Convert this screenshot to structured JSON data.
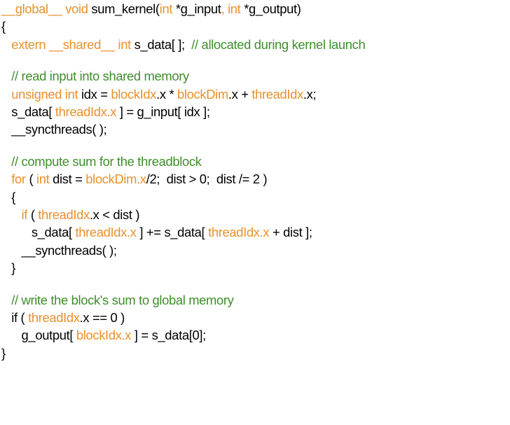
{
  "colors": {
    "keyword": "#e8912c",
    "comment": "#3f8e2b",
    "text": "#000000",
    "background": "#ffffff"
  },
  "code": {
    "lines": [
      {
        "tokens": [
          [
            "o",
            "__global__ void "
          ],
          [
            "k",
            "sum_kernel("
          ],
          [
            "o",
            "int "
          ],
          [
            "k",
            "*g_input"
          ],
          [
            "o",
            ", int "
          ],
          [
            "k",
            "*g_output)"
          ]
        ]
      },
      {
        "tokens": [
          [
            "k",
            "{"
          ]
        ]
      },
      {
        "tokens": [
          [
            "k",
            "   "
          ],
          [
            "o",
            "extern __shared__ int "
          ],
          [
            "k",
            "s_data[ ];  "
          ],
          [
            "g",
            "// allocated during kernel launch"
          ]
        ]
      },
      {
        "blank": true,
        "tokens": []
      },
      {
        "tokens": [
          [
            "k",
            "   "
          ],
          [
            "g",
            "// read input into shared memory"
          ]
        ]
      },
      {
        "tokens": [
          [
            "k",
            "   "
          ],
          [
            "o",
            "unsigned int "
          ],
          [
            "k",
            "idx = "
          ],
          [
            "o",
            "blockIdx"
          ],
          [
            "k",
            ".x * "
          ],
          [
            "o",
            "blockDim"
          ],
          [
            "k",
            ".x + "
          ],
          [
            "o",
            "threadIdx"
          ],
          [
            "k",
            ".x;"
          ]
        ]
      },
      {
        "tokens": [
          [
            "k",
            "   s_data[ "
          ],
          [
            "o",
            "threadIdx.x"
          ],
          [
            "k",
            " ] = g_input[ idx ];"
          ]
        ]
      },
      {
        "tokens": [
          [
            "k",
            "   __syncthreads( );"
          ]
        ]
      },
      {
        "blank": true,
        "tokens": []
      },
      {
        "tokens": [
          [
            "k",
            "   "
          ],
          [
            "g",
            "// compute sum for the threadblock"
          ]
        ]
      },
      {
        "tokens": [
          [
            "k",
            "   "
          ],
          [
            "o",
            "for"
          ],
          [
            "k",
            " ( "
          ],
          [
            "o",
            "int "
          ],
          [
            "k",
            "dist = "
          ],
          [
            "o",
            "blockDim.x"
          ],
          [
            "k",
            "/2;  dist > 0;  dist /= 2 )"
          ]
        ]
      },
      {
        "tokens": [
          [
            "k",
            "   {"
          ]
        ]
      },
      {
        "tokens": [
          [
            "k",
            "      "
          ],
          [
            "o",
            "if"
          ],
          [
            "k",
            " ( "
          ],
          [
            "o",
            "threadIdx"
          ],
          [
            "k",
            ".x < dist )"
          ]
        ]
      },
      {
        "tokens": [
          [
            "k",
            "         s_data[ "
          ],
          [
            "o",
            "threadIdx.x"
          ],
          [
            "k",
            " ] += s_data[ "
          ],
          [
            "o",
            "threadIdx.x"
          ],
          [
            "k",
            " + dist ];"
          ]
        ]
      },
      {
        "tokens": [
          [
            "k",
            "      __syncthreads( );"
          ]
        ]
      },
      {
        "tokens": [
          [
            "k",
            "   }"
          ]
        ]
      },
      {
        "blank": true,
        "tokens": []
      },
      {
        "tokens": [
          [
            "k",
            "   "
          ],
          [
            "g",
            "// write the block's sum to global memory"
          ]
        ]
      },
      {
        "tokens": [
          [
            "k",
            "   if ( "
          ],
          [
            "o",
            "threadIdx"
          ],
          [
            "k",
            ".x == 0 )"
          ]
        ]
      },
      {
        "tokens": [
          [
            "k",
            "      g_output[ "
          ],
          [
            "o",
            "blockIdx.x"
          ],
          [
            "k",
            " ] = s_data[0];"
          ]
        ]
      },
      {
        "tokens": [
          [
            "k",
            "}"
          ]
        ]
      }
    ]
  }
}
